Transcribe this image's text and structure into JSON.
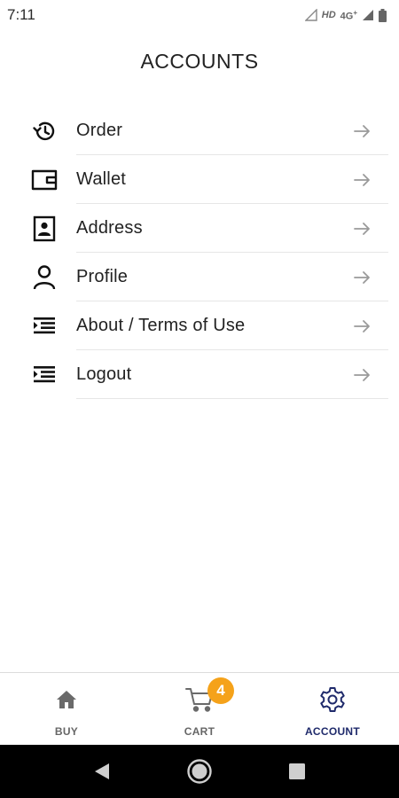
{
  "status_bar": {
    "time": "7:11",
    "network_text": "HD",
    "network_type": "4G",
    "signal_icon": "signal-icon",
    "battery_icon": "battery-icon"
  },
  "page": {
    "title": "ACCOUNTS"
  },
  "menu": {
    "items": [
      {
        "label": "Order",
        "icon": "history-icon"
      },
      {
        "label": "Wallet",
        "icon": "wallet-icon"
      },
      {
        "label": "Address",
        "icon": "contact-card-icon"
      },
      {
        "label": "Profile",
        "icon": "person-icon"
      },
      {
        "label": "About / Terms of Use",
        "icon": "list-icon"
      },
      {
        "label": "Logout",
        "icon": "list-icon"
      }
    ]
  },
  "bottom_nav": {
    "items": [
      {
        "label": "BUY",
        "icon": "home-icon",
        "active": false
      },
      {
        "label": "CART",
        "icon": "cart-icon",
        "active": false,
        "badge": "4"
      },
      {
        "label": "ACCOUNT",
        "icon": "gear-icon",
        "active": true
      }
    ]
  },
  "colors": {
    "accent": "#1f2a6b",
    "badge": "#f5a21a",
    "inactive": "#666666"
  }
}
